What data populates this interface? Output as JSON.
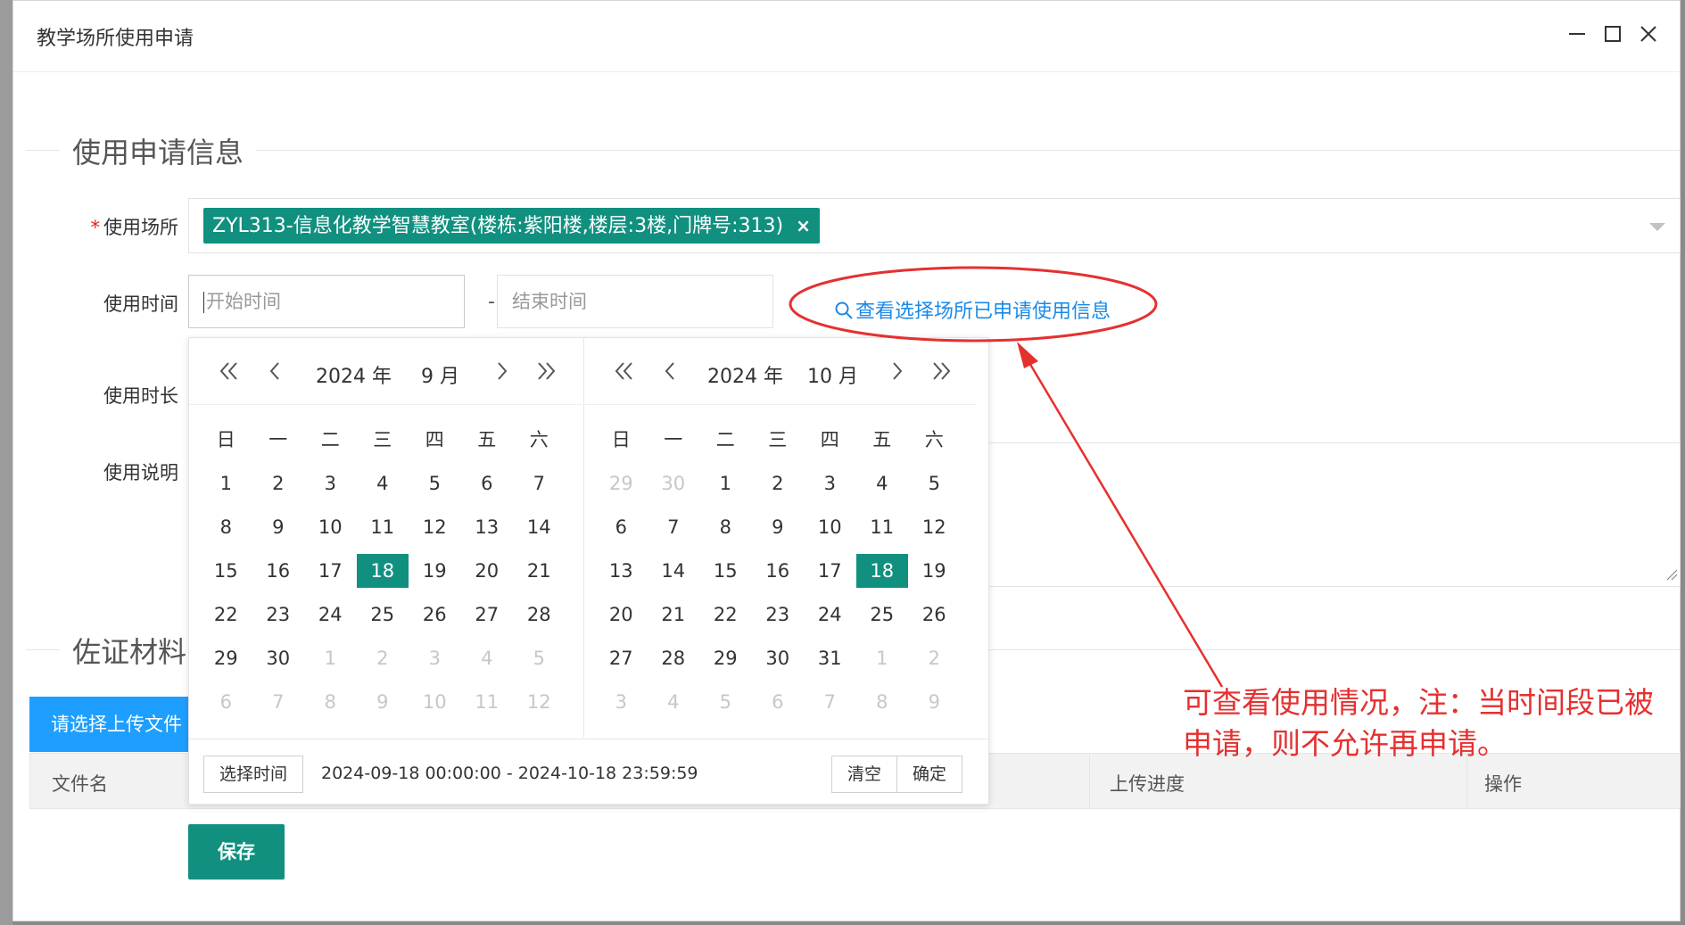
{
  "window": {
    "title": "教学场所使用申请"
  },
  "section_apply": {
    "title": "使用申请信息"
  },
  "form": {
    "venue": {
      "label": "使用场所",
      "required_mark": "*",
      "selected_tag": "ZYL313-信息化教学智慧教室(楼栋:紫阳楼,楼层:3楼,门牌号:313)",
      "tag_remove": "×"
    },
    "time": {
      "label": "使用时间",
      "start_placeholder": "开始时间",
      "separator": "-",
      "end_placeholder": "结束时间",
      "check_link": "查看选择场所已申请使用信息"
    },
    "duration": {
      "label": "使用时长"
    },
    "remark": {
      "label": "使用说明"
    }
  },
  "section_evidence": {
    "title": "佐证材料",
    "upload_button": "请选择上传文件",
    "table_headers": [
      "文件名",
      "上传进度",
      "操作"
    ]
  },
  "save_button": "保存",
  "date_picker": {
    "weekdays": [
      "日",
      "一",
      "二",
      "三",
      "四",
      "五",
      "六"
    ],
    "left": {
      "year": "2024 年",
      "month": "9 月",
      "weeks": [
        [
          {
            "d": "1"
          },
          {
            "d": "2"
          },
          {
            "d": "3"
          },
          {
            "d": "4"
          },
          {
            "d": "5"
          },
          {
            "d": "6"
          },
          {
            "d": "7"
          }
        ],
        [
          {
            "d": "8"
          },
          {
            "d": "9"
          },
          {
            "d": "10"
          },
          {
            "d": "11"
          },
          {
            "d": "12"
          },
          {
            "d": "13"
          },
          {
            "d": "14"
          }
        ],
        [
          {
            "d": "15"
          },
          {
            "d": "16"
          },
          {
            "d": "17"
          },
          {
            "d": "18",
            "s": true
          },
          {
            "d": "19"
          },
          {
            "d": "20"
          },
          {
            "d": "21"
          }
        ],
        [
          {
            "d": "22"
          },
          {
            "d": "23"
          },
          {
            "d": "24"
          },
          {
            "d": "25"
          },
          {
            "d": "26"
          },
          {
            "d": "27"
          },
          {
            "d": "28"
          }
        ],
        [
          {
            "d": "29"
          },
          {
            "d": "30"
          },
          {
            "d": "1",
            "m": true
          },
          {
            "d": "2",
            "m": true
          },
          {
            "d": "3",
            "m": true
          },
          {
            "d": "4",
            "m": true
          },
          {
            "d": "5",
            "m": true
          }
        ],
        [
          {
            "d": "6",
            "m": true
          },
          {
            "d": "7",
            "m": true
          },
          {
            "d": "8",
            "m": true
          },
          {
            "d": "9",
            "m": true
          },
          {
            "d": "10",
            "m": true
          },
          {
            "d": "11",
            "m": true
          },
          {
            "d": "12",
            "m": true
          }
        ]
      ]
    },
    "right": {
      "year": "2024 年",
      "month": "10 月",
      "weeks": [
        [
          {
            "d": "29",
            "m": true
          },
          {
            "d": "30",
            "m": true
          },
          {
            "d": "1"
          },
          {
            "d": "2"
          },
          {
            "d": "3"
          },
          {
            "d": "4"
          },
          {
            "d": "5"
          }
        ],
        [
          {
            "d": "6"
          },
          {
            "d": "7"
          },
          {
            "d": "8"
          },
          {
            "d": "9"
          },
          {
            "d": "10"
          },
          {
            "d": "11"
          },
          {
            "d": "12"
          }
        ],
        [
          {
            "d": "13"
          },
          {
            "d": "14"
          },
          {
            "d": "15"
          },
          {
            "d": "16"
          },
          {
            "d": "17"
          },
          {
            "d": "18",
            "s": true
          },
          {
            "d": "19"
          }
        ],
        [
          {
            "d": "20"
          },
          {
            "d": "21"
          },
          {
            "d": "22"
          },
          {
            "d": "23"
          },
          {
            "d": "24"
          },
          {
            "d": "25"
          },
          {
            "d": "26"
          }
        ],
        [
          {
            "d": "27"
          },
          {
            "d": "28"
          },
          {
            "d": "29"
          },
          {
            "d": "30"
          },
          {
            "d": "31"
          },
          {
            "d": "1",
            "m": true
          },
          {
            "d": "2",
            "m": true
          }
        ],
        [
          {
            "d": "3",
            "m": true
          },
          {
            "d": "4",
            "m": true
          },
          {
            "d": "5",
            "m": true
          },
          {
            "d": "6",
            "m": true
          },
          {
            "d": "7",
            "m": true
          },
          {
            "d": "8",
            "m": true
          },
          {
            "d": "9",
            "m": true
          }
        ]
      ]
    },
    "footer": {
      "choose_time": "选择时间",
      "range": "2024-09-18 00:00:00 - 2024-10-18 23:59:59",
      "clear": "清空",
      "confirm": "确定"
    }
  },
  "annotation": {
    "text": "可查看使用情况，注：当时间段已被申请，则不允许再申请。",
    "color": "#e53030"
  },
  "colors": {
    "accent": "#119080",
    "link": "#1a8ae8",
    "upload": "#1e9fff"
  }
}
